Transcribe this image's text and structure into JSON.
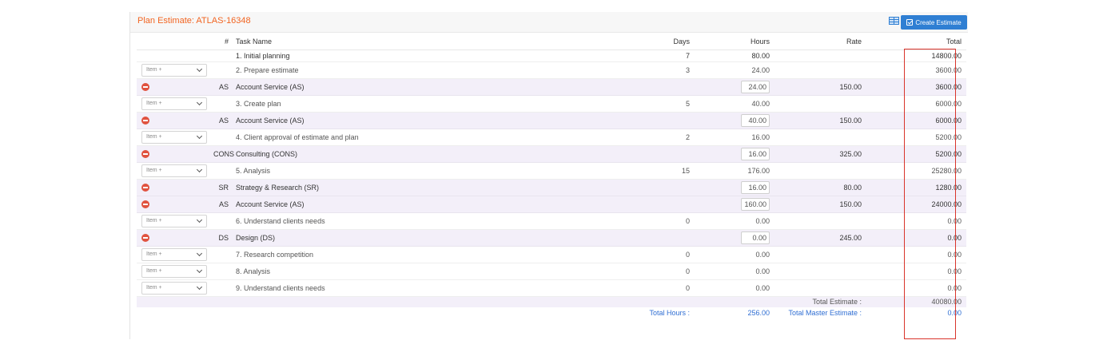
{
  "header": {
    "title": "Plan Estimate: ATLAS-16348",
    "create_button": "Create Estimate",
    "grid_icon": "table-icon"
  },
  "columns": {
    "num": "#",
    "task_name": "Task Name",
    "days": "Days",
    "hours": "Hours",
    "rate": "Rate",
    "total": "Total"
  },
  "select_placeholder": "Item +",
  "rows": [
    {
      "type": "task",
      "name": "1. Initial planning",
      "days": "7",
      "hours": "80.00",
      "total": "14800.00"
    },
    {
      "type": "task",
      "name": "2.   Prepare estimate",
      "days": "3",
      "hours": "24.00",
      "total": "3600.00"
    },
    {
      "type": "sub",
      "code": "AS",
      "name": "Account Service (AS)",
      "hours": "24.00",
      "rate": "150.00",
      "total": "3600.00"
    },
    {
      "type": "task",
      "name": "3.   Create plan",
      "days": "5",
      "hours": "40.00",
      "total": "6000.00"
    },
    {
      "type": "sub",
      "code": "AS",
      "name": "Account Service (AS)",
      "hours": "40.00",
      "rate": "150.00",
      "total": "6000.00"
    },
    {
      "type": "task",
      "name": "4.   Client approval of estimate and plan",
      "days": "2",
      "hours": "16.00",
      "total": "5200.00"
    },
    {
      "type": "sub",
      "code": "CONS",
      "name": "Consulting (CONS)",
      "hours": "16.00",
      "rate": "325.00",
      "total": "5200.00"
    },
    {
      "type": "task",
      "name": "5. Analysis",
      "days": "15",
      "hours": "176.00",
      "total": "25280.00"
    },
    {
      "type": "sub",
      "code": "SR",
      "name": "Strategy & Research (SR)",
      "hours": "16.00",
      "rate": "80.00",
      "total": "1280.00"
    },
    {
      "type": "sub",
      "code": "AS",
      "name": "Account Service (AS)",
      "hours": "160.00",
      "rate": "150.00",
      "total": "24000.00"
    },
    {
      "type": "task",
      "name": "6. Understand clients needs",
      "days": "0",
      "hours": "0.00",
      "total": "0.00"
    },
    {
      "type": "sub",
      "code": "DS",
      "name": "Design (DS)",
      "hours": "0.00",
      "rate": "245.00",
      "total": "0.00"
    },
    {
      "type": "task",
      "name": "7. Research competition",
      "days": "0",
      "hours": "0.00",
      "total": "0.00"
    },
    {
      "type": "task",
      "name": "8. Analysis",
      "days": "0",
      "hours": "0.00",
      "total": "0.00"
    },
    {
      "type": "task",
      "name": "9. Understand clients needs",
      "days": "0",
      "hours": "0.00",
      "total": "0.00"
    }
  ],
  "totals": {
    "total_estimate_label": "Total Estimate :",
    "total_estimate": "40080.00",
    "total_hours_label": "Total Hours :",
    "total_hours": "256.00",
    "total_master_label": "Total Master Estimate :",
    "total_master": "0.00"
  },
  "colors": {
    "title": "#f26522",
    "button": "#2f7fd3",
    "remove": "#e0523f",
    "highlight": "#d9342b"
  }
}
